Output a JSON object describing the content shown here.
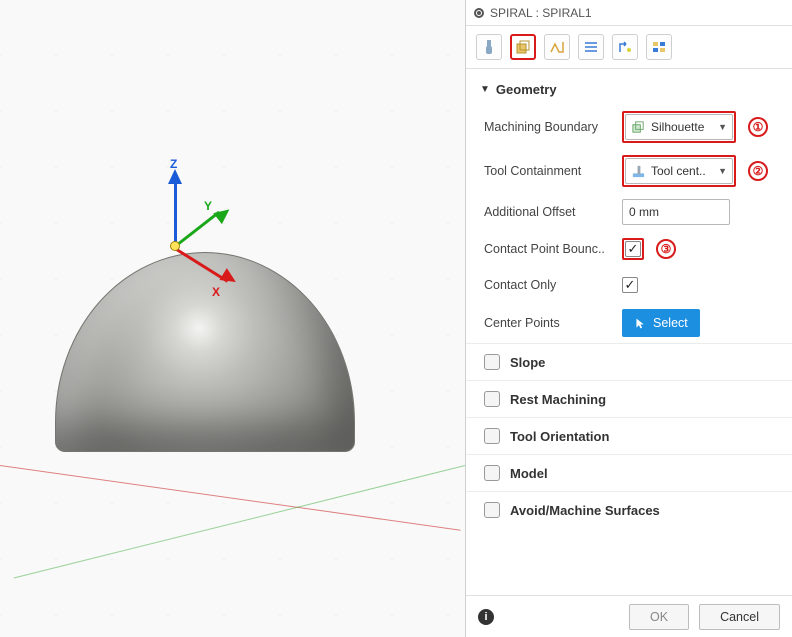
{
  "panel": {
    "title": "SPIRAL : SPIRAL1",
    "tabs": [
      "tool-tab",
      "geometry-tab",
      "heights-tab",
      "passes-tab",
      "linking-tab",
      "misc-tab"
    ],
    "active_tab_index": 1
  },
  "geometry": {
    "header": "Geometry",
    "machining_boundary": {
      "label": "Machining Boundary",
      "value": "Silhouette",
      "callout": "①"
    },
    "tool_containment": {
      "label": "Tool Containment",
      "value": "Tool cent..",
      "callout": "②"
    },
    "additional_offset": {
      "label": "Additional Offset",
      "value": "0 mm"
    },
    "contact_point_boundary": {
      "label": "Contact Point Bounc..",
      "checked": true,
      "callout": "③"
    },
    "contact_only": {
      "label": "Contact Only",
      "checked": true
    },
    "center_points": {
      "label": "Center Points",
      "button": "Select"
    }
  },
  "collapsed_sections": {
    "slope": "Slope",
    "rest_machining": "Rest Machining",
    "tool_orientation": "Tool Orientation",
    "model": "Model",
    "avoid_machine_surfaces": "Avoid/Machine Surfaces"
  },
  "footer": {
    "ok": "OK",
    "cancel": "Cancel"
  },
  "axes": {
    "x": "X",
    "y": "Y",
    "z": "Z"
  }
}
